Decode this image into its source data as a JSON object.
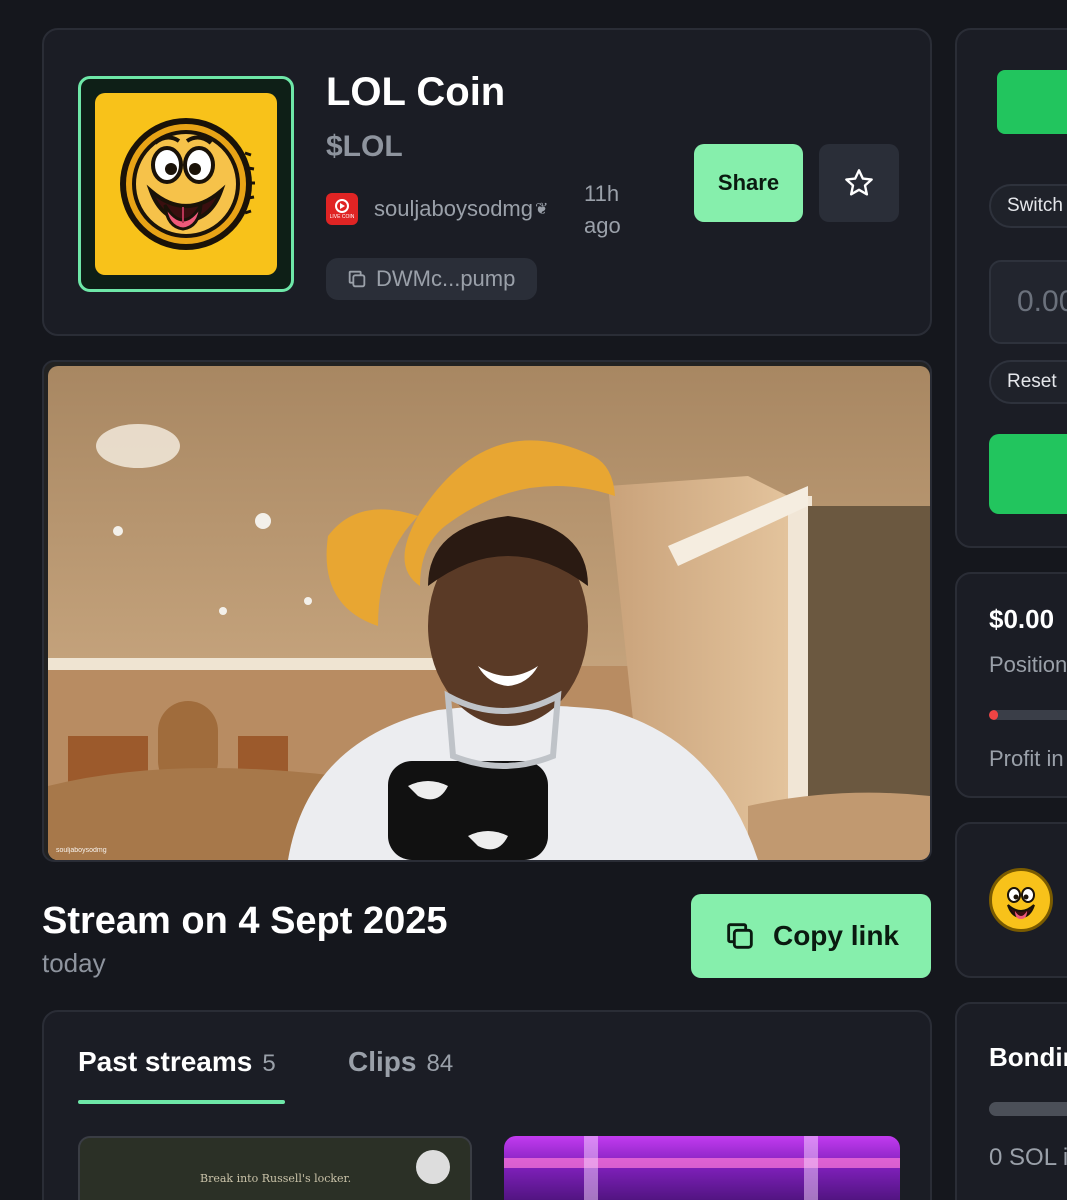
{
  "token": {
    "name": "LOL Coin",
    "ticker": "$LOL",
    "creator": "souljaboysodmg",
    "age": "11h ago",
    "contract_short": "DWMc...pump",
    "live_badge_label": "LIVE COIN"
  },
  "actions": {
    "share_label": "Share",
    "favorite_icon": "star-icon"
  },
  "video": {
    "overlay_handle": "souljaboysodmg"
  },
  "stream": {
    "title": "Stream on 4 Sept 2025",
    "subtitle": "today",
    "copy_link_label": "Copy link"
  },
  "tabs": [
    {
      "label": "Past streams",
      "count": "5",
      "active": true
    },
    {
      "label": "Clips",
      "count": "84",
      "active": false
    }
  ],
  "thumbnails": {
    "first_caption": "Break into Russell's locker."
  },
  "trade_panel": {
    "switch_label": "Switch",
    "amount_placeholder": "0.00",
    "reset_label": "Reset"
  },
  "position": {
    "value": "$0.00",
    "label": "Position",
    "bar_fill_fraction": 0.08,
    "profit_label": "Profit in"
  },
  "bonding": {
    "title": "Bonding",
    "sol_text": "0 SOL i"
  },
  "colors": {
    "background": "#15171d",
    "card": "#1b1d25",
    "accent_green": "#86efac",
    "bright_green": "#22c55e",
    "coin_yellow": "#f8c21a"
  }
}
